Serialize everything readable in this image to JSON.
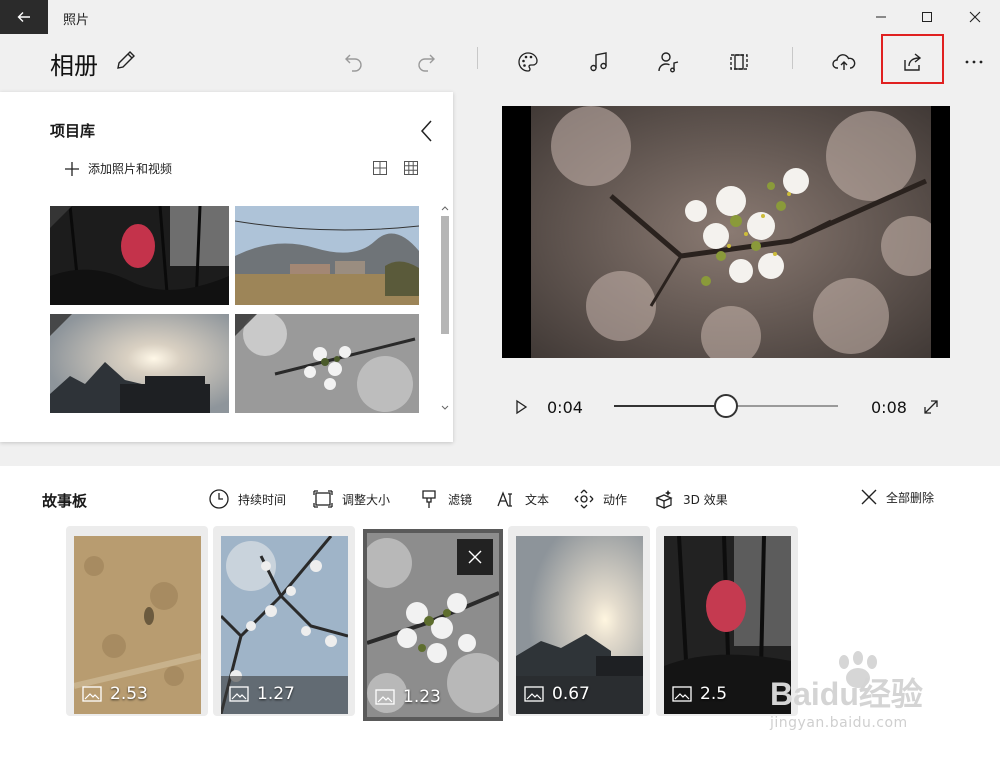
{
  "window": {
    "title": "照片"
  },
  "toolbar": {
    "album_title": "相册"
  },
  "library": {
    "title": "项目库",
    "add_label": "添加照片和视频"
  },
  "player": {
    "current_time": "0:04",
    "total_time": "0:08",
    "progress": 0.5
  },
  "storyboard": {
    "title": "故事板",
    "tools": [
      {
        "label": "持续时间",
        "icon": "clock-icon"
      },
      {
        "label": "调整大小",
        "icon": "resize-icon"
      },
      {
        "label": "滤镜",
        "icon": "filter-icon"
      },
      {
        "label": "文本",
        "icon": "text-icon"
      },
      {
        "label": "动作",
        "icon": "motion-icon"
      },
      {
        "label": "3D 效果",
        "icon": "3d-effects-icon"
      }
    ],
    "delete_all_label": "全部删除",
    "cards": [
      {
        "duration": "2.53"
      },
      {
        "duration": "1.27"
      },
      {
        "duration": "1.23"
      },
      {
        "duration": "0.67"
      },
      {
        "duration": "2.5"
      }
    ]
  },
  "watermark": {
    "brand": "Baidu经验",
    "site": "jingyan.baidu.com"
  },
  "colors": {
    "highlight": "#e02020",
    "titlebar_back": "#2b2b2b"
  }
}
